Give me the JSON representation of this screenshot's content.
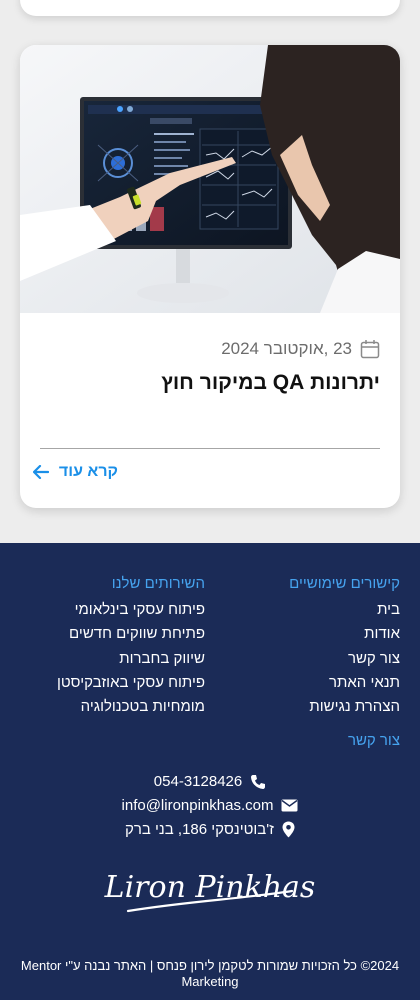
{
  "article": {
    "date": "23 ,אוקטובר 2024",
    "title": "יתרונות QA במיקור חוץ",
    "read_more": "קרא עוד",
    "image_alt": "אישה מצביעה על מסך עם נתוני בדיקות"
  },
  "footer": {
    "quick_links": {
      "heading": "קישורים שימושיים",
      "items": [
        "בית",
        "אודות",
        "צור קשר",
        "תנאי האתר",
        "הצהרת נגישות"
      ]
    },
    "services": {
      "heading": "השירותים שלנו",
      "items": [
        "פיתוח עסקי בינלאומי",
        "פתיחת שווקים חדשים",
        "שיווק בחברות",
        "פיתוח עסקי באוזבקיסטן",
        "מומחיות בטכנולוגיה"
      ]
    },
    "contact": {
      "heading": "צור קשר",
      "phone": "054-3128426",
      "email": "info@lironpinkhas.com",
      "address": "ז'בוטינסקי 186, בני ברק"
    },
    "logo_text": "Liron Pinkhas",
    "copyright": "2024© כל הזכויות שמורות לטקמן לירון פנחס | האתר נבנה ע\"י Mentor Marketing"
  },
  "colors": {
    "accent": "#1a8fe8",
    "footer_bg": "#1b2b57",
    "footer_heading": "#46a3ef"
  },
  "icons": [
    "calendar-icon",
    "arrow-left-icon",
    "phone-icon",
    "mail-icon",
    "location-pin-icon"
  ]
}
